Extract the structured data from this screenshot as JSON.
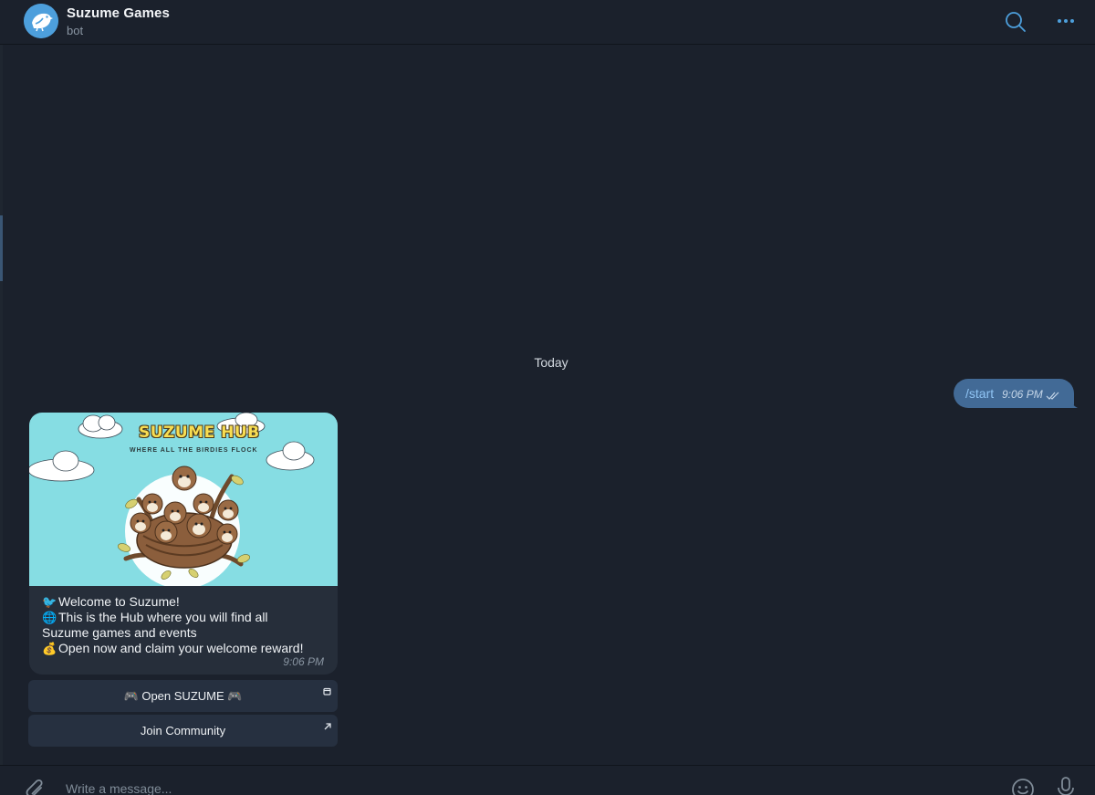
{
  "header": {
    "title": "Suzume Games",
    "subtitle": "bot",
    "avatar_icon": "bird-logo-icon",
    "search_icon": "search-icon",
    "more_icon": "more-dots-icon"
  },
  "chat": {
    "date_separator": "Today",
    "outgoing": {
      "text": "/start",
      "time": "9:06 PM",
      "status_icon": "double-check-icon"
    },
    "incoming": {
      "image": {
        "title": "SUZUME HUB",
        "subtitle": "WHERE ALL THE BIRDIES FLOCK"
      },
      "lines": [
        {
          "emoji": "🐦",
          "text": "Welcome to Suzume!"
        },
        {
          "emoji": "🌐",
          "text": "This is the Hub where you will find all"
        },
        {
          "emoji": "",
          "text": "Suzume games and events"
        },
        {
          "emoji": "💰",
          "text": "Open now and claim your welcome reward!"
        }
      ],
      "time": "9:06 PM"
    },
    "keyboard": [
      {
        "label": "🎮 Open SUZUME 🎮",
        "corner_icon": "web-app-icon"
      },
      {
        "label": "Join Community",
        "corner_icon": "external-link-icon"
      }
    ]
  },
  "composer": {
    "placeholder": "Write a message...",
    "attach_icon": "paperclip-icon",
    "emoji_icon": "smiley-icon",
    "mic_icon": "microphone-icon"
  },
  "colors": {
    "background": "#1b212c",
    "accent": "#4d9fdc",
    "outgoing_bubble": "#426a96",
    "incoming_bubble": "#262e3a",
    "button": "#263040"
  }
}
